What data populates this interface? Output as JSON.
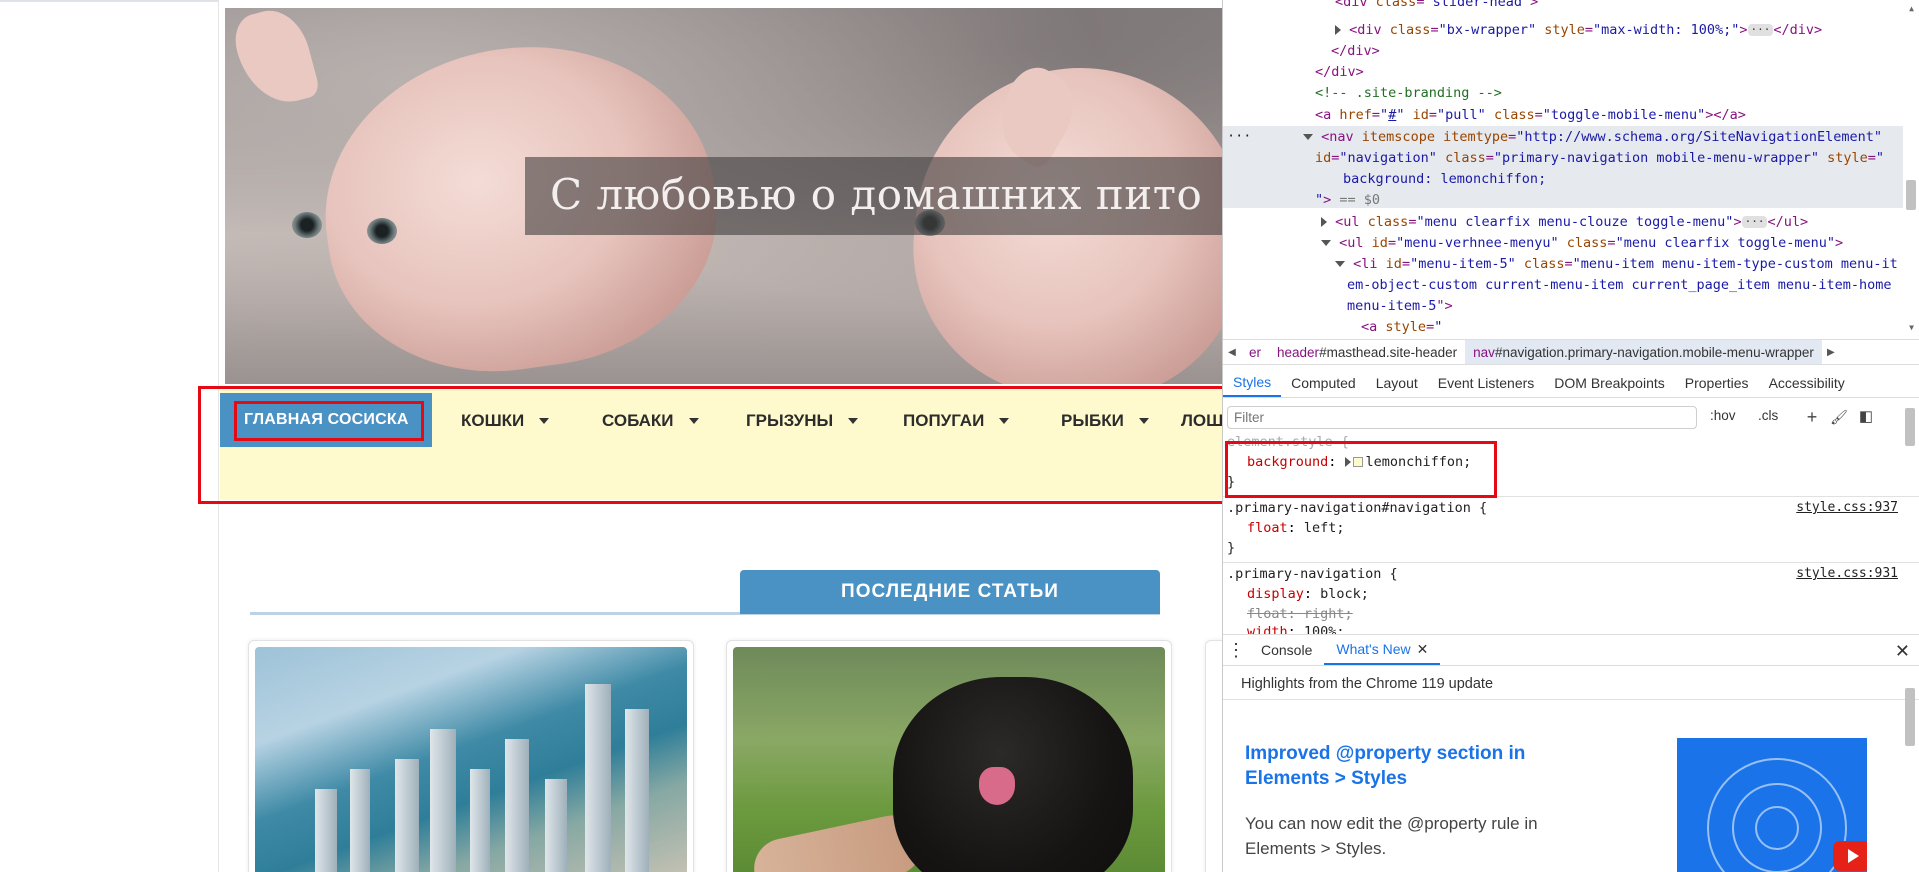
{
  "site": {
    "hero_title": "С любовью о домашних пито",
    "nav": {
      "home": "ГЛАВНАЯ СОСИСКА",
      "items": [
        "КОШКИ",
        "СОБАКИ",
        "ГРЫЗУНЫ",
        "ПОПУГАИ",
        "РЫБКИ",
        "ЛОШ"
      ],
      "background": "lemonchiffon"
    },
    "section_heading": "ПОСЛЕДНИЕ СТАТЬИ"
  },
  "devtools": {
    "dom_lines": [
      {
        "indent": 0,
        "html": "div class=\"slider-head\""
      },
      {
        "t1": "div",
        "a1": "class",
        "v1": "bx-wrapper",
        "a2": "style",
        "v2": "max-width: 100%;",
        "close": "div"
      },
      {
        "close_div": "</div>"
      },
      {
        "close_div2": "</div>"
      },
      {
        "comment": "<!-- .site-branding -->"
      },
      {
        "a_href": "#",
        "a_id": "pull",
        "a_class": "toggle-mobile-menu"
      },
      {
        "nav_itemtype": "http://www.schema.org/SiteNavigationElement"
      },
      {
        "nav_id": "navigation",
        "nav_class": "primary-navigation mobile-menu-wrapper",
        "nav_style": "background: lemonchiffon;"
      },
      {
        "eq": "== $0"
      },
      {
        "ul1_class": "menu clearfix menu-clouze toggle-menu"
      },
      {
        "ul2_id": "menu-verhnee-menyu",
        "ul2_class": "menu clearfix toggle-menu"
      },
      {
        "li_id": "menu-item-5",
        "li_class1": "menu-item menu-item-type-custom menu-it",
        "li_class2": "em-object-custom current-menu-item current_page_item menu-item-home",
        "li_class3": "menu-item-5"
      },
      {
        "a_style": "a style=\""
      }
    ],
    "breadcrumbs": [
      {
        "tag": "er",
        "rest": ""
      },
      {
        "tag": "header",
        "rest": "#masthead.site-header"
      },
      {
        "tag": "nav",
        "rest": "#navigation.primary-navigation.mobile-menu-wrapper"
      }
    ],
    "tabs": [
      "Styles",
      "Computed",
      "Layout",
      "Event Listeners",
      "DOM Breakpoints",
      "Properties",
      "Accessibility"
    ],
    "active_tab": "Styles",
    "filter_placeholder": "Filter",
    "hov": ":hov",
    "cls": ".cls",
    "styles": {
      "element_style": "element.style {",
      "bg_prop": "background",
      "bg_val": "lemonchiffon;",
      "rule1_sel": ".primary-navigation#navigation {",
      "rule1_src": "style.css:937",
      "rule1_prop": "float",
      "rule1_val": "left;",
      "rule2_sel": ".primary-navigation {",
      "rule2_src": "style.css:931",
      "rule2_p1": "display",
      "rule2_v1": "block;",
      "rule2_p2": "float",
      "rule2_v2": "right;",
      "rule2_p3": "width",
      "rule2_v3": "100%;",
      "close": "}"
    },
    "drawer": {
      "tabs": [
        "Console",
        "What's New"
      ],
      "active": "What's New",
      "subtitle": "Highlights from the Chrome 119 update",
      "card_title": "Improved @property section in Elements > Styles",
      "card_desc": "You can now edit the @property rule in Elements > Styles."
    }
  }
}
